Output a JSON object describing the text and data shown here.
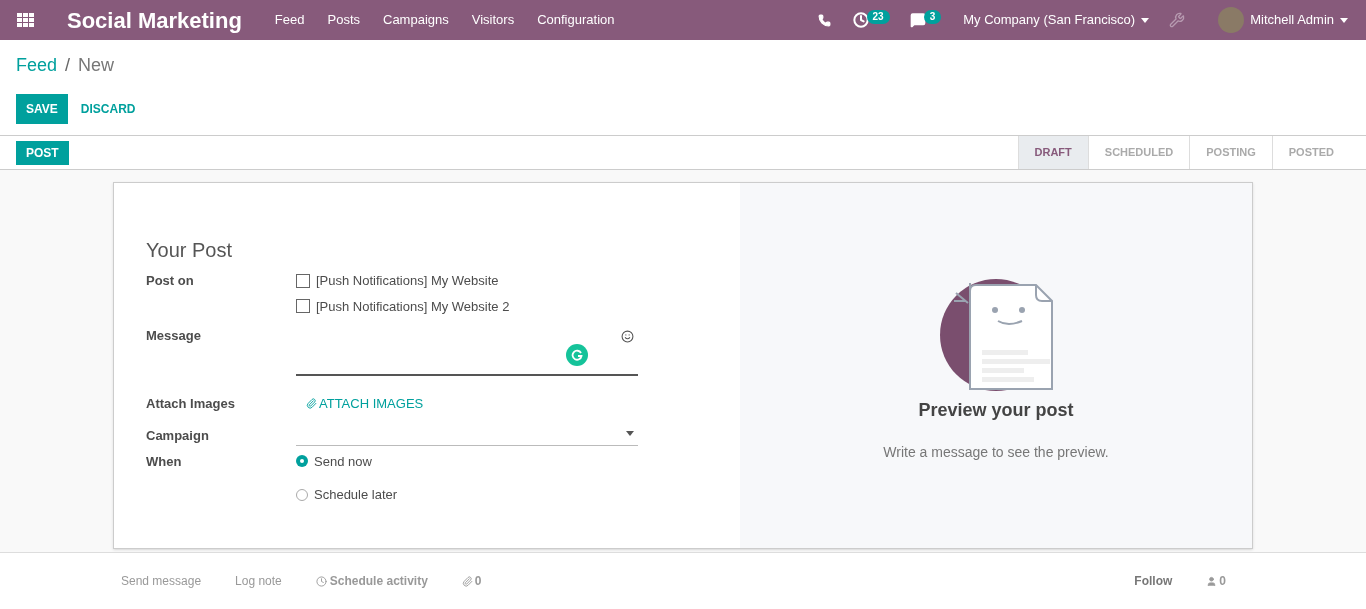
{
  "navbar": {
    "app_title": "Social Marketing",
    "menu": [
      "Feed",
      "Posts",
      "Campaigns",
      "Visitors",
      "Configuration"
    ],
    "activity_count": "23",
    "message_count": "3",
    "company": "My Company (San Francisco)",
    "user": "Mitchell Admin"
  },
  "breadcrumb": {
    "parent": "Feed",
    "separator": "/",
    "current": "New"
  },
  "actions": {
    "save": "SAVE",
    "discard": "DISCARD"
  },
  "header_button": "POST",
  "stages": [
    {
      "label": "DRAFT",
      "selected": true
    },
    {
      "label": "SCHEDULED",
      "selected": false
    },
    {
      "label": "POSTING",
      "selected": false
    },
    {
      "label": "POSTED",
      "selected": false
    }
  ],
  "form": {
    "title": "Your Post",
    "post_on_label": "Post on",
    "accounts": [
      {
        "label": "[Push Notifications] My Website",
        "checked": false
      },
      {
        "label": "[Push Notifications] My Website 2",
        "checked": false
      }
    ],
    "message_label": "Message",
    "attach_label": "Attach Images",
    "attach_button": "ATTACH IMAGES",
    "campaign_label": "Campaign",
    "when_label": "When",
    "when_options": [
      {
        "label": "Send now",
        "selected": true
      },
      {
        "label": "Schedule later",
        "selected": false
      }
    ]
  },
  "preview": {
    "title": "Preview your post",
    "subtitle": "Write a message to see the preview."
  },
  "chatter": {
    "send_message": "Send message",
    "log_note": "Log note",
    "schedule_activity": "Schedule activity",
    "attachments": "0",
    "follow": "Follow",
    "followers": "0"
  }
}
